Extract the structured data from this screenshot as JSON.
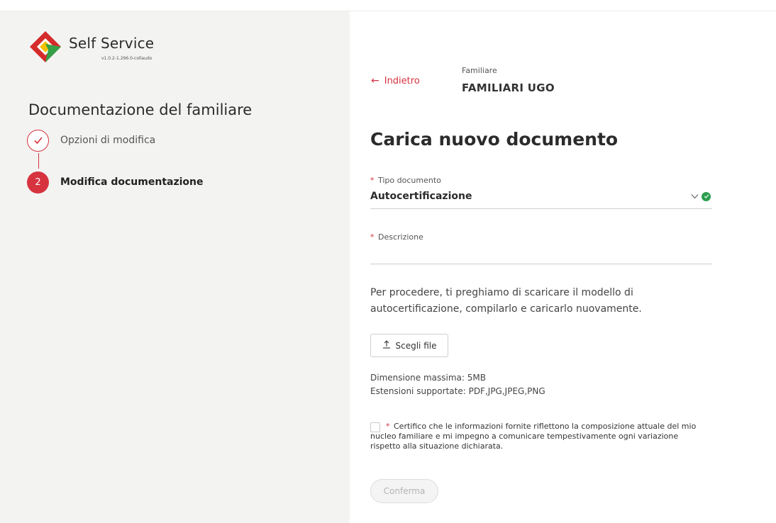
{
  "app": {
    "brand_name": "Self Service",
    "version": "v1.0.2-1.296.0-collaudo"
  },
  "sidebar": {
    "title": "Documentazione del familiare",
    "steps": [
      {
        "number": "",
        "label": "Opzioni di modifica",
        "state": "completed"
      },
      {
        "number": "2",
        "label": "Modifica documentazione",
        "state": "active"
      }
    ]
  },
  "header": {
    "back_label": "Indietro",
    "familiare_label": "Familiare",
    "familiare_name": "FAMILIARI UGO"
  },
  "form": {
    "title": "Carica nuovo documento",
    "tipo_documento": {
      "label": "Tipo documento",
      "value": "Autocertificazione",
      "required_mark": "*"
    },
    "descrizione": {
      "label": "Descrizione",
      "value": "",
      "required_mark": "*"
    },
    "info_text": "Per procedere, ti preghiamo di scaricare il modello di autocertificazione, compilarlo e caricarlo nuovamente.",
    "file_button_label": "Scegli file",
    "max_size_text": "Dimensione massima: 5MB",
    "extensions_text": "Estensioni supportate: PDF,JPG,JPEG,PNG",
    "consent": {
      "required_mark": "*",
      "text": "Certifico che le informazioni fornite riflettono la composizione attuale del mio nucleo familiare e mi impegno a comunicare tempestivamente ogni variazione rispetto alla situazione dichiarata.",
      "checked": false
    },
    "confirm_label": "Conferma"
  },
  "colors": {
    "accent": "#d6333f",
    "success": "#2e9e4f",
    "sidebar_bg": "#f3f3f2",
    "logo_red": "#d52b2b",
    "logo_green": "#35a046",
    "logo_yellow": "#f6c200"
  },
  "icons": {
    "back": "arrow-left-icon",
    "step_done": "check-icon",
    "select": "chevron-down-icon",
    "valid": "check-circle-icon",
    "upload": "upload-icon"
  }
}
